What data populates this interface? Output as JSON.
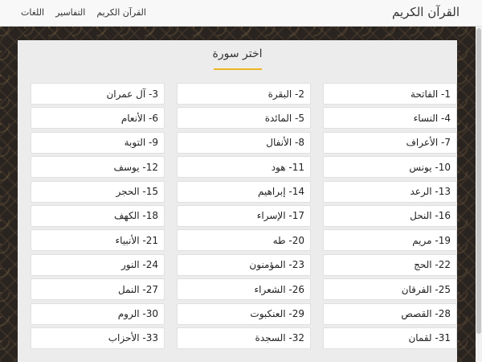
{
  "header": {
    "brand": "القرآن الكريم",
    "nav": [
      "القرآن الكريم",
      "التفاسير",
      "اللغات"
    ]
  },
  "main": {
    "title": "اختر سورة",
    "accent_color": "#f0b429",
    "surahs": [
      "1- الفاتحة",
      "2- البقرة",
      "3- آل عمران",
      "4- النساء",
      "5- المائدة",
      "6- الأنعام",
      "7- الأعراف",
      "8- الأنفال",
      "9- التوبة",
      "10- يونس",
      "11- هود",
      "12- يوسف",
      "13- الرعد",
      "14- إبراهيم",
      "15- الحجر",
      "16- النحل",
      "17- الإسراء",
      "18- الكهف",
      "19- مريم",
      "20- طه",
      "21- الأنبياء",
      "22- الحج",
      "23- المؤمنون",
      "24- النور",
      "25- الفرقان",
      "26- الشعراء",
      "27- النمل",
      "28- القصص",
      "29- العنكبوت",
      "30- الروم",
      "31- لقمان",
      "32- السجدة",
      "33- الأحزاب"
    ]
  }
}
